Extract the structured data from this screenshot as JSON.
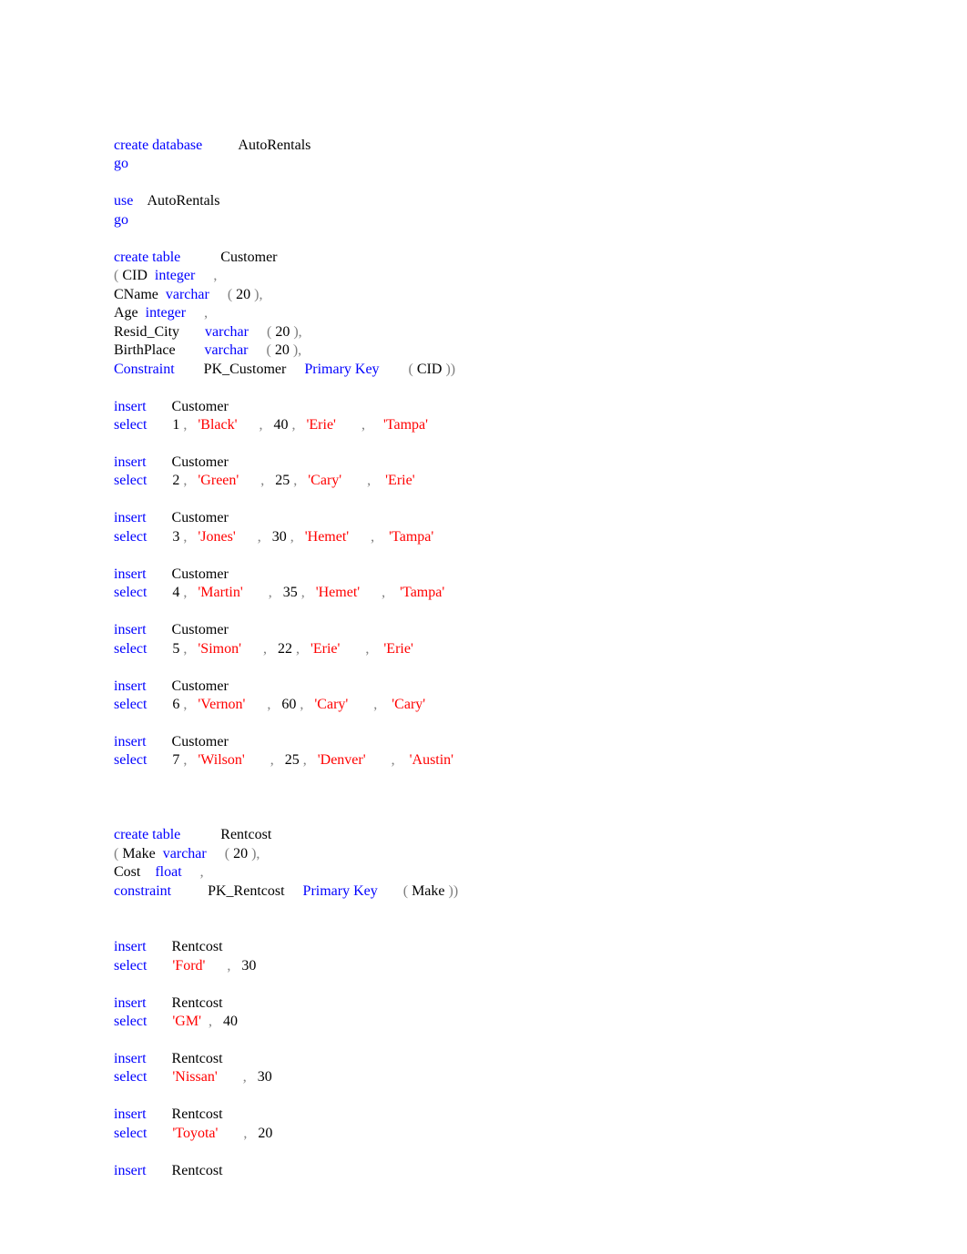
{
  "lines": [
    [
      {
        "cls": "kw",
        "t": "create database"
      },
      {
        "cls": "ident",
        "t": "          AutoRentals"
      }
    ],
    [
      {
        "cls": "kw",
        "t": "go"
      }
    ],
    [
      {
        "cls": "",
        "t": ""
      }
    ],
    [
      {
        "cls": "kw",
        "t": "use"
      },
      {
        "cls": "ident",
        "t": "    AutoRentals"
      }
    ],
    [
      {
        "cls": "kw",
        "t": "go"
      }
    ],
    [
      {
        "cls": "",
        "t": ""
      }
    ],
    [
      {
        "cls": "kw",
        "t": "create table"
      },
      {
        "cls": "ident",
        "t": "           Customer"
      }
    ],
    [
      {
        "cls": "gray",
        "t": "( "
      },
      {
        "cls": "ident",
        "t": "CID  "
      },
      {
        "cls": "kw",
        "t": "integer"
      },
      {
        "cls": "gray",
        "t": "     ,"
      }
    ],
    [
      {
        "cls": "ident",
        "t": "CName  "
      },
      {
        "cls": "kw",
        "t": "varchar"
      },
      {
        "cls": "gray",
        "t": "     ( "
      },
      {
        "cls": "num",
        "t": "20"
      },
      {
        "cls": "gray",
        "t": " ),"
      }
    ],
    [
      {
        "cls": "ident",
        "t": "Age  "
      },
      {
        "cls": "kw",
        "t": "integer"
      },
      {
        "cls": "gray",
        "t": "     ,"
      }
    ],
    [
      {
        "cls": "ident",
        "t": "Resid_City       "
      },
      {
        "cls": "kw",
        "t": "varchar"
      },
      {
        "cls": "gray",
        "t": "     ( "
      },
      {
        "cls": "num",
        "t": "20"
      },
      {
        "cls": "gray",
        "t": " ),"
      }
    ],
    [
      {
        "cls": "ident",
        "t": "BirthPlace        "
      },
      {
        "cls": "kw",
        "t": "varchar"
      },
      {
        "cls": "gray",
        "t": "     ( "
      },
      {
        "cls": "num",
        "t": "20"
      },
      {
        "cls": "gray",
        "t": " ),"
      }
    ],
    [
      {
        "cls": "kw",
        "t": "Constraint"
      },
      {
        "cls": "ident",
        "t": "        PK_Customer     "
      },
      {
        "cls": "kw",
        "t": "Primary Key"
      },
      {
        "cls": "gray",
        "t": "        ( "
      },
      {
        "cls": "ident",
        "t": "CID"
      },
      {
        "cls": "gray",
        "t": " ))"
      }
    ],
    [
      {
        "cls": "",
        "t": ""
      }
    ],
    [
      {
        "cls": "kw",
        "t": "insert"
      },
      {
        "cls": "ident",
        "t": "       Customer"
      }
    ],
    [
      {
        "cls": "kw",
        "t": "select"
      },
      {
        "cls": "ident",
        "t": "       "
      },
      {
        "cls": "num",
        "t": "1"
      },
      {
        "cls": "gray",
        "t": " ,   "
      },
      {
        "cls": "str",
        "t": "'Black'"
      },
      {
        "cls": "gray",
        "t": "      ,   "
      },
      {
        "cls": "num",
        "t": "40"
      },
      {
        "cls": "gray",
        "t": " ,   "
      },
      {
        "cls": "str",
        "t": "'Erie'"
      },
      {
        "cls": "gray",
        "t": "       ,     "
      },
      {
        "cls": "str",
        "t": "'Tampa'"
      }
    ],
    [
      {
        "cls": "",
        "t": ""
      }
    ],
    [
      {
        "cls": "kw",
        "t": "insert"
      },
      {
        "cls": "ident",
        "t": "       Customer"
      }
    ],
    [
      {
        "cls": "kw",
        "t": "select"
      },
      {
        "cls": "ident",
        "t": "       "
      },
      {
        "cls": "num",
        "t": "2"
      },
      {
        "cls": "gray",
        "t": " ,   "
      },
      {
        "cls": "str",
        "t": "'Green'"
      },
      {
        "cls": "gray",
        "t": "      ,   "
      },
      {
        "cls": "num",
        "t": "25"
      },
      {
        "cls": "gray",
        "t": " ,   "
      },
      {
        "cls": "str",
        "t": "'Cary'"
      },
      {
        "cls": "gray",
        "t": "       ,    "
      },
      {
        "cls": "str",
        "t": "'Erie'"
      }
    ],
    [
      {
        "cls": "",
        "t": ""
      }
    ],
    [
      {
        "cls": "kw",
        "t": "insert"
      },
      {
        "cls": "ident",
        "t": "       Customer"
      }
    ],
    [
      {
        "cls": "kw",
        "t": "select"
      },
      {
        "cls": "ident",
        "t": "       "
      },
      {
        "cls": "num",
        "t": "3"
      },
      {
        "cls": "gray",
        "t": " ,   "
      },
      {
        "cls": "str",
        "t": "'Jones'"
      },
      {
        "cls": "gray",
        "t": "      ,   "
      },
      {
        "cls": "num",
        "t": "30"
      },
      {
        "cls": "gray",
        "t": " ,   "
      },
      {
        "cls": "str",
        "t": "'Hemet'"
      },
      {
        "cls": "gray",
        "t": "      ,    "
      },
      {
        "cls": "str",
        "t": "'Tampa'"
      }
    ],
    [
      {
        "cls": "",
        "t": ""
      }
    ],
    [
      {
        "cls": "kw",
        "t": "insert"
      },
      {
        "cls": "ident",
        "t": "       Customer"
      }
    ],
    [
      {
        "cls": "kw",
        "t": "select"
      },
      {
        "cls": "ident",
        "t": "       "
      },
      {
        "cls": "num",
        "t": "4"
      },
      {
        "cls": "gray",
        "t": " ,   "
      },
      {
        "cls": "str",
        "t": "'Martin'"
      },
      {
        "cls": "gray",
        "t": "       ,   "
      },
      {
        "cls": "num",
        "t": "35"
      },
      {
        "cls": "gray",
        "t": " ,   "
      },
      {
        "cls": "str",
        "t": "'Hemet'"
      },
      {
        "cls": "gray",
        "t": "      ,    "
      },
      {
        "cls": "str",
        "t": "'Tampa'"
      }
    ],
    [
      {
        "cls": "",
        "t": ""
      }
    ],
    [
      {
        "cls": "kw",
        "t": "insert"
      },
      {
        "cls": "ident",
        "t": "       Customer"
      }
    ],
    [
      {
        "cls": "kw",
        "t": "select"
      },
      {
        "cls": "ident",
        "t": "       "
      },
      {
        "cls": "num",
        "t": "5"
      },
      {
        "cls": "gray",
        "t": " ,   "
      },
      {
        "cls": "str",
        "t": "'Simon'"
      },
      {
        "cls": "gray",
        "t": "      ,   "
      },
      {
        "cls": "num",
        "t": "22"
      },
      {
        "cls": "gray",
        "t": " ,   "
      },
      {
        "cls": "str",
        "t": "'Erie'"
      },
      {
        "cls": "gray",
        "t": "       ,    "
      },
      {
        "cls": "str",
        "t": "'Erie'"
      }
    ],
    [
      {
        "cls": "",
        "t": ""
      }
    ],
    [
      {
        "cls": "kw",
        "t": "insert"
      },
      {
        "cls": "ident",
        "t": "       Customer"
      }
    ],
    [
      {
        "cls": "kw",
        "t": "select"
      },
      {
        "cls": "ident",
        "t": "       "
      },
      {
        "cls": "num",
        "t": "6"
      },
      {
        "cls": "gray",
        "t": " ,   "
      },
      {
        "cls": "str",
        "t": "'Vernon'"
      },
      {
        "cls": "gray",
        "t": "      ,   "
      },
      {
        "cls": "num",
        "t": "60"
      },
      {
        "cls": "gray",
        "t": " ,   "
      },
      {
        "cls": "str",
        "t": "'Cary'"
      },
      {
        "cls": "gray",
        "t": "       ,    "
      },
      {
        "cls": "str",
        "t": "'Cary'"
      }
    ],
    [
      {
        "cls": "",
        "t": ""
      }
    ],
    [
      {
        "cls": "kw",
        "t": "insert"
      },
      {
        "cls": "ident",
        "t": "       Customer"
      }
    ],
    [
      {
        "cls": "kw",
        "t": "select"
      },
      {
        "cls": "ident",
        "t": "       "
      },
      {
        "cls": "num",
        "t": "7"
      },
      {
        "cls": "gray",
        "t": " ,   "
      },
      {
        "cls": "str",
        "t": "'Wilson'"
      },
      {
        "cls": "gray",
        "t": "       ,   "
      },
      {
        "cls": "num",
        "t": "25"
      },
      {
        "cls": "gray",
        "t": " ,   "
      },
      {
        "cls": "str",
        "t": "'Denver'"
      },
      {
        "cls": "gray",
        "t": "       ,    "
      },
      {
        "cls": "str",
        "t": "'Austin'"
      }
    ],
    [
      {
        "cls": "",
        "t": ""
      }
    ],
    [
      {
        "cls": "",
        "t": ""
      }
    ],
    [
      {
        "cls": "",
        "t": ""
      }
    ],
    [
      {
        "cls": "kw",
        "t": "create table"
      },
      {
        "cls": "ident",
        "t": "           Rentcost"
      }
    ],
    [
      {
        "cls": "gray",
        "t": "( "
      },
      {
        "cls": "ident",
        "t": "Make  "
      },
      {
        "cls": "kw",
        "t": "varchar"
      },
      {
        "cls": "gray",
        "t": "     ( "
      },
      {
        "cls": "num",
        "t": "20"
      },
      {
        "cls": "gray",
        "t": " ),"
      }
    ],
    [
      {
        "cls": "ident",
        "t": "Cost    "
      },
      {
        "cls": "kw",
        "t": "float"
      },
      {
        "cls": "gray",
        "t": "     ,"
      }
    ],
    [
      {
        "cls": "kw",
        "t": "constraint"
      },
      {
        "cls": "ident",
        "t": "          PK_Rentcost     "
      },
      {
        "cls": "kw",
        "t": "Primary Key"
      },
      {
        "cls": "gray",
        "t": "       ( "
      },
      {
        "cls": "ident",
        "t": "Make"
      },
      {
        "cls": "gray",
        "t": " ))"
      }
    ],
    [
      {
        "cls": "",
        "t": ""
      }
    ],
    [
      {
        "cls": "",
        "t": ""
      }
    ],
    [
      {
        "cls": "kw",
        "t": "insert"
      },
      {
        "cls": "ident",
        "t": "       Rentcost"
      }
    ],
    [
      {
        "cls": "kw",
        "t": "select"
      },
      {
        "cls": "ident",
        "t": "       "
      },
      {
        "cls": "str",
        "t": "'Ford'"
      },
      {
        "cls": "gray",
        "t": "      ,   "
      },
      {
        "cls": "num",
        "t": "30"
      }
    ],
    [
      {
        "cls": "",
        "t": ""
      }
    ],
    [
      {
        "cls": "kw",
        "t": "insert"
      },
      {
        "cls": "ident",
        "t": "       Rentcost"
      }
    ],
    [
      {
        "cls": "kw",
        "t": "select"
      },
      {
        "cls": "ident",
        "t": "       "
      },
      {
        "cls": "str",
        "t": "'GM'"
      },
      {
        "cls": "gray",
        "t": "  ,   "
      },
      {
        "cls": "num",
        "t": "40"
      }
    ],
    [
      {
        "cls": "",
        "t": ""
      }
    ],
    [
      {
        "cls": "kw",
        "t": "insert"
      },
      {
        "cls": "ident",
        "t": "       Rentcost"
      }
    ],
    [
      {
        "cls": "kw",
        "t": "select"
      },
      {
        "cls": "ident",
        "t": "       "
      },
      {
        "cls": "str",
        "t": "'Nissan'"
      },
      {
        "cls": "gray",
        "t": "       ,   "
      },
      {
        "cls": "num",
        "t": "30"
      }
    ],
    [
      {
        "cls": "",
        "t": ""
      }
    ],
    [
      {
        "cls": "kw",
        "t": "insert"
      },
      {
        "cls": "ident",
        "t": "       Rentcost"
      }
    ],
    [
      {
        "cls": "kw",
        "t": "select"
      },
      {
        "cls": "ident",
        "t": "       "
      },
      {
        "cls": "str",
        "t": "'Toyota'"
      },
      {
        "cls": "gray",
        "t": "       ,   "
      },
      {
        "cls": "num",
        "t": "20"
      }
    ],
    [
      {
        "cls": "",
        "t": ""
      }
    ],
    [
      {
        "cls": "kw",
        "t": "insert"
      },
      {
        "cls": "ident",
        "t": "       Rentcost"
      }
    ]
  ]
}
